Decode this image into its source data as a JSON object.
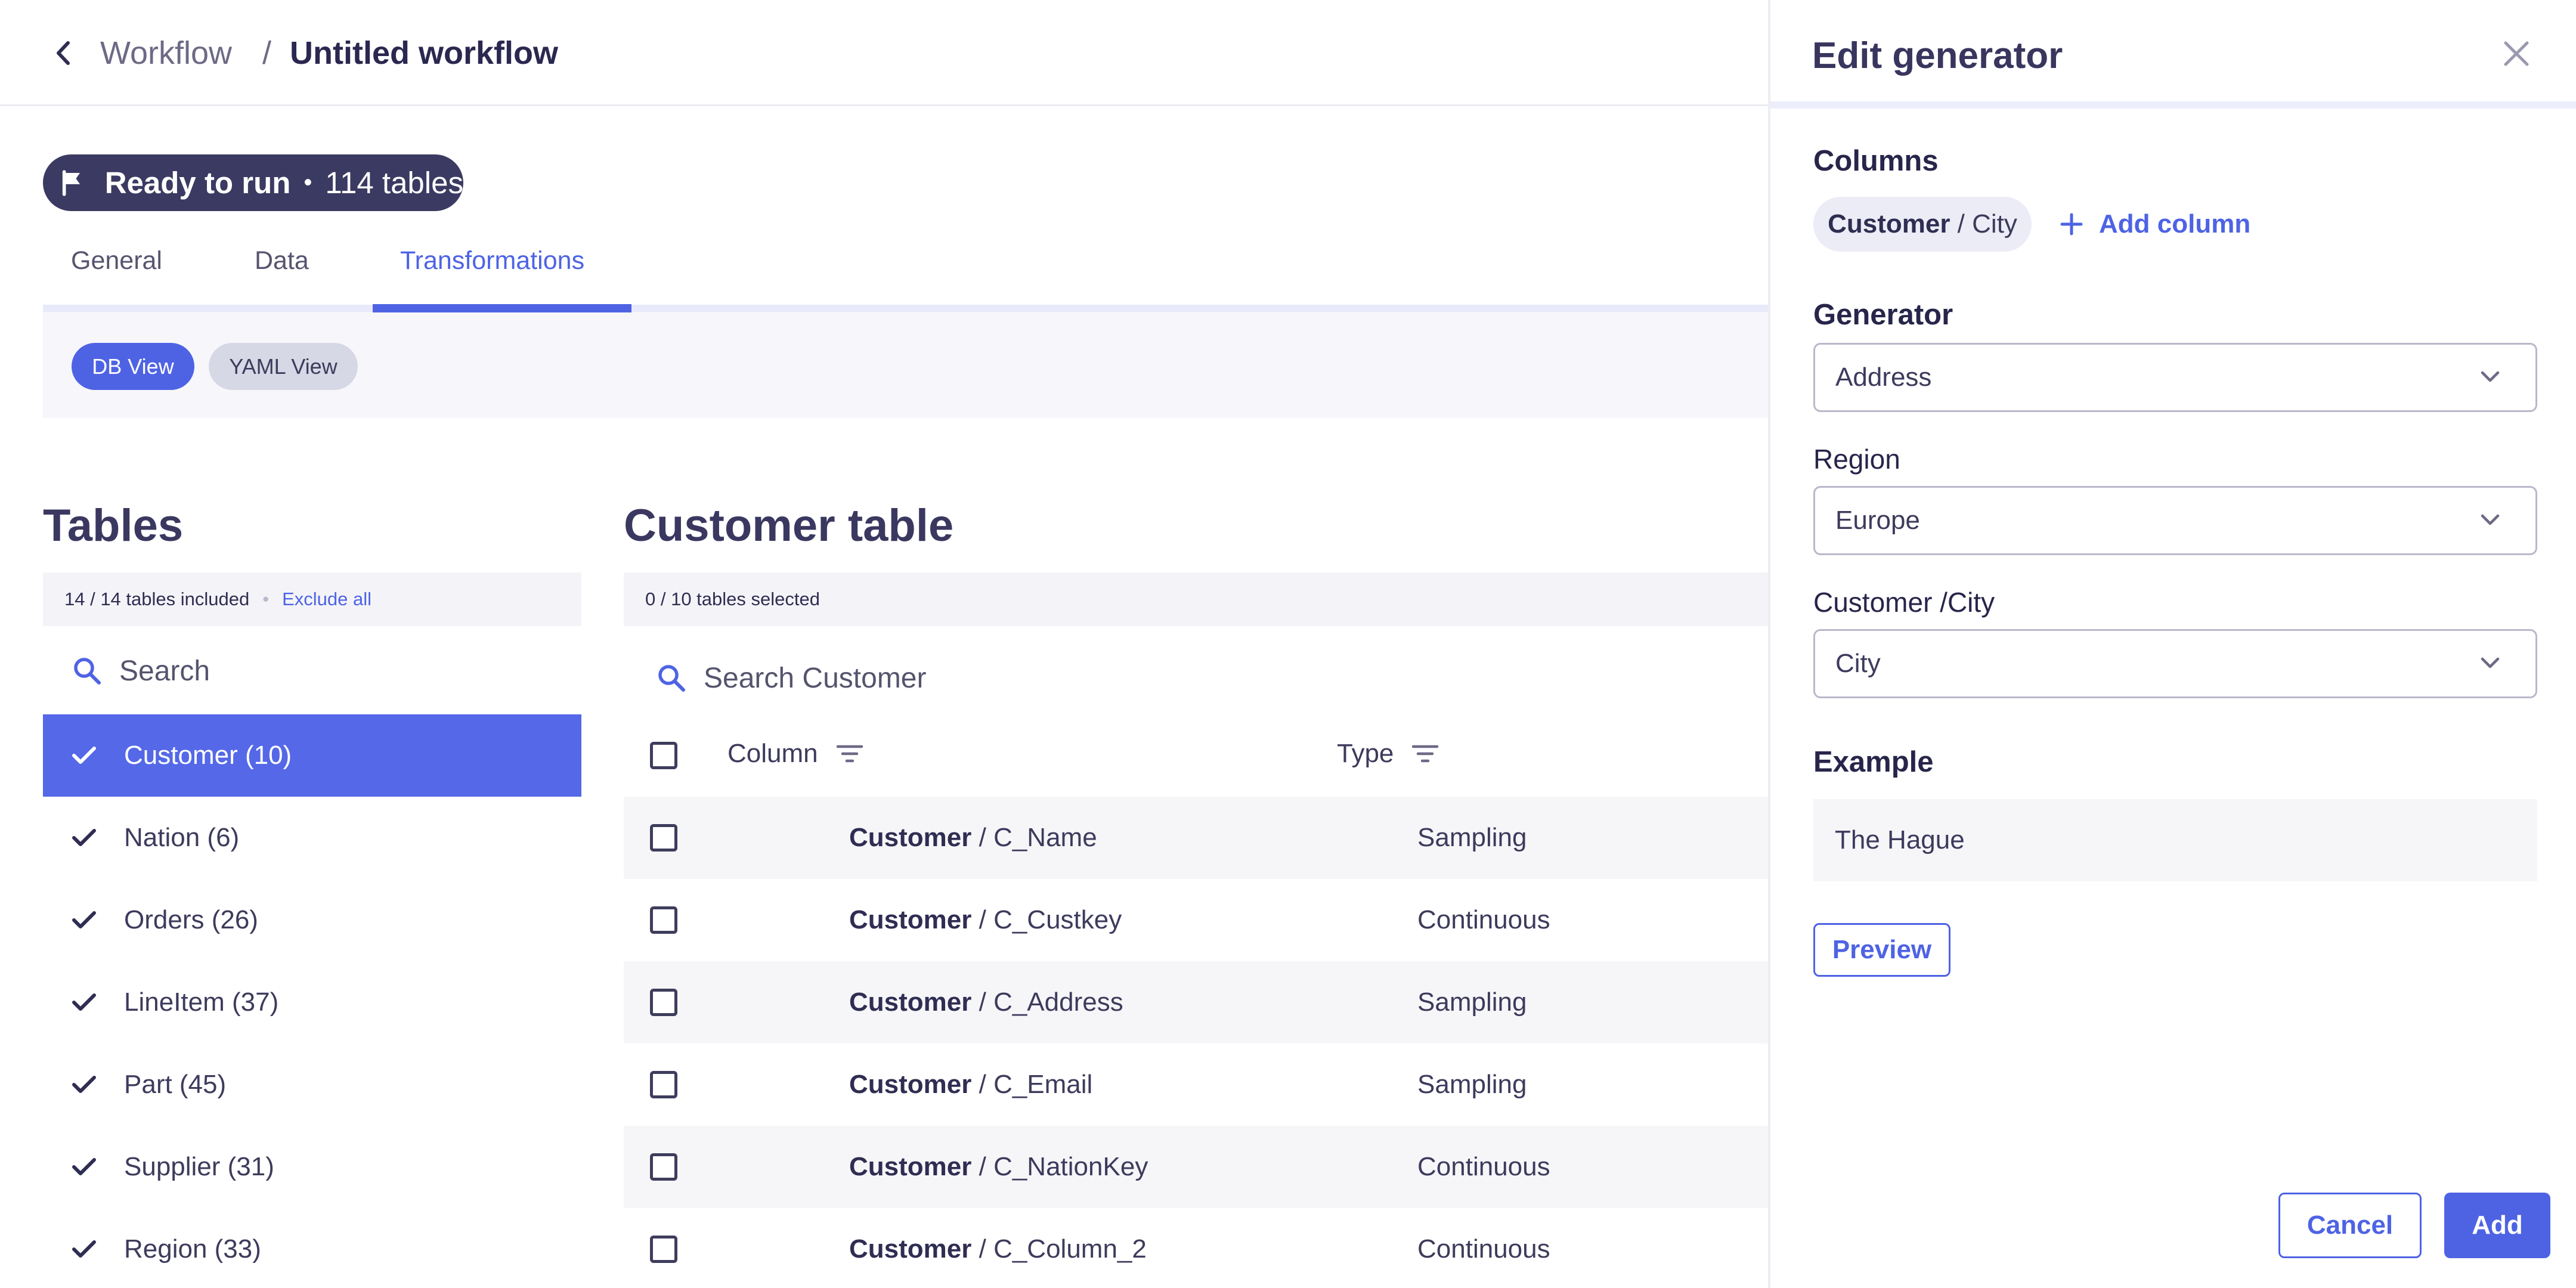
{
  "breadcrumb": {
    "parent": "Workflow",
    "separator": "/",
    "current": "Untitled workflow"
  },
  "status": {
    "label": "Ready to run",
    "dot": "•",
    "count": "114 tables"
  },
  "tabs": [
    {
      "label": "General",
      "active": false
    },
    {
      "label": "Data",
      "active": false
    },
    {
      "label": "Transformations",
      "active": true
    }
  ],
  "view_toggle": {
    "db": "DB View",
    "yaml": "YAML View",
    "selected": "DB View"
  },
  "tables_panel": {
    "title": "Tables",
    "info": "14 / 14 tables included",
    "dot": "•",
    "exclude_link": "Exclude all",
    "search_placeholder": "Search",
    "items": [
      {
        "label": "Customer (10)",
        "selected": true
      },
      {
        "label": "Nation (6)",
        "selected": false
      },
      {
        "label": "Orders (26)",
        "selected": false
      },
      {
        "label": "LineItem (37)",
        "selected": false
      },
      {
        "label": "Part (45)",
        "selected": false
      },
      {
        "label": "Supplier (31)",
        "selected": false
      },
      {
        "label": "Region (33)",
        "selected": false
      }
    ]
  },
  "customer_table": {
    "title": "Customer table",
    "info": "0 / 10 tables selected",
    "search_placeholder": "Search Customer",
    "headers": {
      "column": "Column",
      "type": "Type"
    },
    "rows": [
      {
        "table": "Customer",
        "sep": " / ",
        "column": "C_Name",
        "type": "Sampling"
      },
      {
        "table": "Customer",
        "sep": " / ",
        "column": "C_Custkey",
        "type": "Continuous"
      },
      {
        "table": "Customer",
        "sep": " / ",
        "column": "C_Address",
        "type": "Sampling"
      },
      {
        "table": "Customer",
        "sep": " / ",
        "column": "C_Email",
        "type": "Sampling"
      },
      {
        "table": "Customer",
        "sep": " / ",
        "column": "C_NationKey",
        "type": "Continuous"
      },
      {
        "table": "Customer",
        "sep": " / ",
        "column": "C_Column_2",
        "type": "Continuous"
      }
    ]
  },
  "edit_panel": {
    "title": "Edit generator",
    "columns_label": "Columns",
    "chip": {
      "table": "Customer",
      "sep": " / ",
      "column": "City"
    },
    "add_column": "Add column",
    "generator_label": "Generator",
    "generator_value": "Address",
    "region_label": "Region",
    "region_value": "Europe",
    "customer_city_label": "Customer /City",
    "customer_city_value": "City",
    "example_label": "Example",
    "example_value": "The Hague",
    "preview": "Preview",
    "cancel": "Cancel",
    "add": "Add"
  },
  "colors": {
    "accent": "#4e63e4",
    "status_pill": "#3b3a62",
    "selected_row": "#5468e8"
  },
  "icons": [
    "chevron-left-icon",
    "flag-icon",
    "search-icon",
    "check-icon",
    "filter-icon",
    "close-icon",
    "plus-icon",
    "chevron-down-icon"
  ]
}
